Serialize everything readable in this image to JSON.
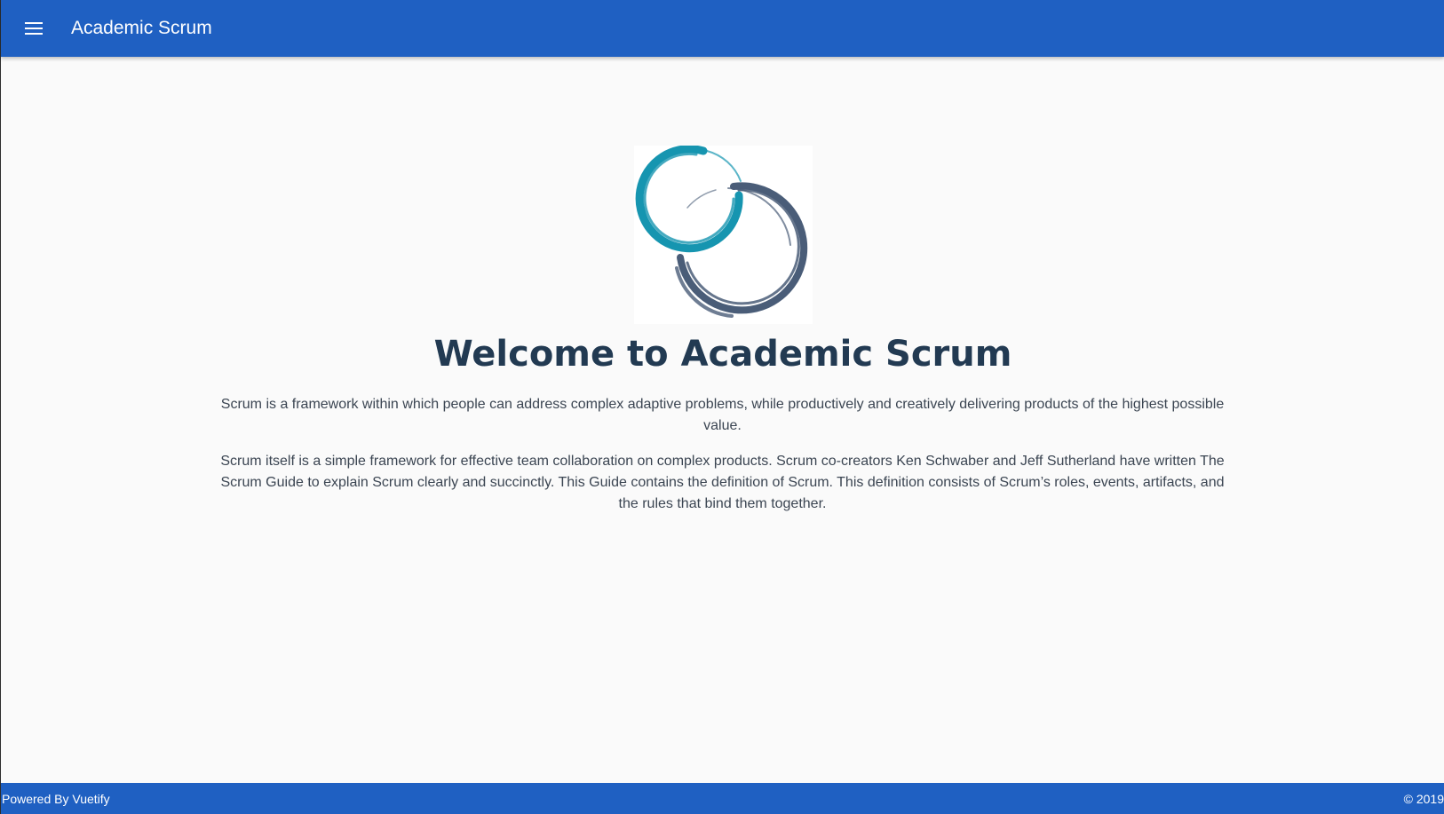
{
  "toolbar": {
    "menu_icon": "menu-icon",
    "title": "Academic Scrum"
  },
  "main": {
    "logo_icon": "scrum-circles-logo",
    "heading": "Welcome to Academic Scrum",
    "paragraph_1": "Scrum is a framework within which people can address complex adaptive problems, while productively and creatively delivering products of the highest possible value.",
    "paragraph_2": "Scrum itself is a simple framework for effective team collaboration on complex products. Scrum co-creators Ken Schwaber and Jeff Sutherland have written The Scrum Guide to explain Scrum clearly and succinctly. This Guide contains the definition of Scrum. This definition consists of Scrum’s roles, events, artifacts, and the rules that bind them together."
  },
  "footer": {
    "left_text": "Powered By Vuetify",
    "right_text": "© 2019"
  },
  "colors": {
    "primary": "#1f60c2",
    "heading": "#223a52",
    "logo_teal": "#1695b0",
    "logo_slate": "#4a5d78",
    "background": "#fafafa"
  }
}
